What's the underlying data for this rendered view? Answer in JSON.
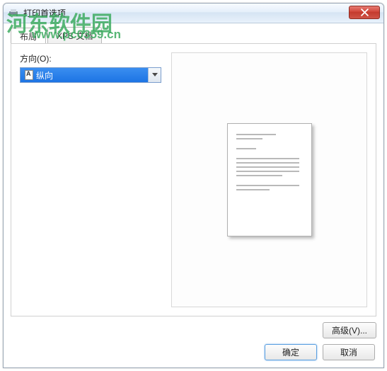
{
  "window": {
    "title": "打印首选项"
  },
  "watermark": {
    "logo": "河东软件园",
    "url": "www.pc0359.cn"
  },
  "tabs": {
    "layout": "布局",
    "xps": "XPS 文档"
  },
  "orientation": {
    "label": "方向(O):",
    "value": "纵向"
  },
  "buttons": {
    "advanced": "高级(V)...",
    "ok": "确定",
    "cancel": "取消"
  }
}
